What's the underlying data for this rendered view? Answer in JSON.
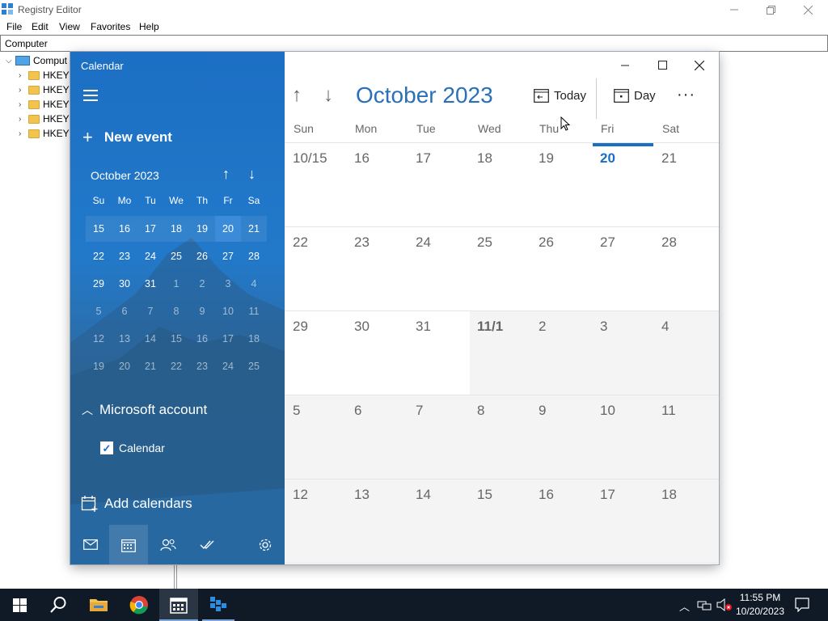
{
  "registry": {
    "title": "Registry Editor",
    "menu": [
      "File",
      "Edit",
      "View",
      "Favorites",
      "Help"
    ],
    "address": "Computer",
    "tree_root": "Comput",
    "tree_items": [
      "HKEY",
      "HKEY",
      "HKEY",
      "HKEY",
      "HKEY"
    ]
  },
  "calendar": {
    "window_title": "Calendar",
    "new_event": "New event",
    "plus": "+",
    "mini": {
      "month": "October 2023",
      "dow": [
        "Su",
        "Mo",
        "Tu",
        "We",
        "Th",
        "Fr",
        "Sa"
      ],
      "weeks": [
        [
          "15",
          "16",
          "17",
          "18",
          "19",
          "20",
          "21"
        ],
        [
          "22",
          "23",
          "24",
          "25",
          "26",
          "27",
          "28"
        ],
        [
          "29",
          "30",
          "31",
          "1",
          "2",
          "3",
          "4"
        ],
        [
          "5",
          "6",
          "7",
          "8",
          "9",
          "10",
          "11"
        ],
        [
          "12",
          "13",
          "14",
          "15",
          "16",
          "17",
          "18"
        ],
        [
          "19",
          "20",
          "21",
          "22",
          "23",
          "24",
          "25"
        ]
      ],
      "selected": "20"
    },
    "account": "Microsoft account",
    "calendar_item": "Calendar",
    "add_calendars": "Add calendars",
    "header": {
      "month": "October 2023",
      "today": "Today",
      "day": "Day",
      "more": "···"
    },
    "dow": [
      "Sun",
      "Mon",
      "Tue",
      "Wed",
      "Thu",
      "Fri",
      "Sat"
    ],
    "weeks": [
      [
        "10/15",
        "16",
        "17",
        "18",
        "19",
        "20",
        "21"
      ],
      [
        "22",
        "23",
        "24",
        "25",
        "26",
        "27",
        "28"
      ],
      [
        "29",
        "30",
        "31",
        "11/1",
        "2",
        "3",
        "4"
      ],
      [
        "5",
        "6",
        "7",
        "8",
        "9",
        "10",
        "11"
      ],
      [
        "12",
        "13",
        "14",
        "15",
        "16",
        "17",
        "18"
      ]
    ],
    "today_date": "20",
    "accent": "#1a6fc4"
  },
  "taskbar": {
    "time": "11:55 PM",
    "date": "10/20/2023"
  }
}
